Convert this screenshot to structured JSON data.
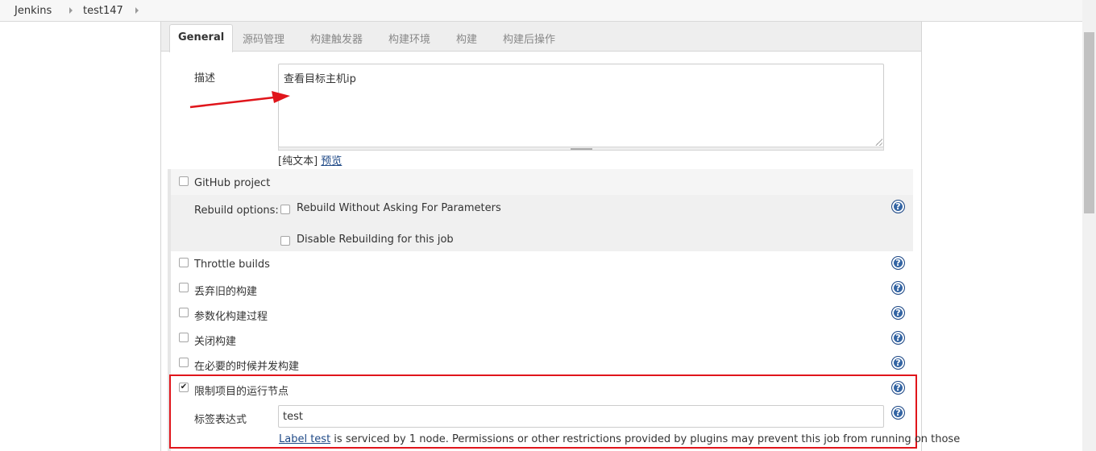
{
  "breadcrumb": {
    "items": [
      "Jenkins",
      "test147"
    ]
  },
  "tabs": [
    "General",
    "源码管理",
    "构建触发器",
    "构建环境",
    "构建",
    "构建后操作"
  ],
  "description": {
    "label": "描述",
    "value": "查看目标主机ip",
    "format_prefix": "[纯文本]",
    "preview_link": "预览"
  },
  "options": {
    "github_project": "GitHub project",
    "rebuild_label": "Rebuild options:",
    "rebuild_without_asking": "Rebuild Without Asking For Parameters",
    "disable_rebuilding": "Disable Rebuilding for this job",
    "throttle_builds": "Throttle builds",
    "discard_old_builds": "丢弃旧的构建",
    "parameterized": "参数化构建过程",
    "disable_build": "关闭构建",
    "concurrent_builds": "在必要的时候并发构建",
    "restrict_node": "限制项目的运行节点",
    "restrict_node_checked": true
  },
  "label_expression": {
    "label": "标签表达式",
    "value": "test",
    "link_text": "Label test",
    "note": " is serviced by 1 node. Permissions or other restrictions provided by plugins may prevent this job from running on those"
  },
  "help_icon_glyph": "?",
  "colors": {
    "annotation_red": "#e0151b",
    "help_blue": "#3465a4",
    "link_blue": "#204a87"
  }
}
